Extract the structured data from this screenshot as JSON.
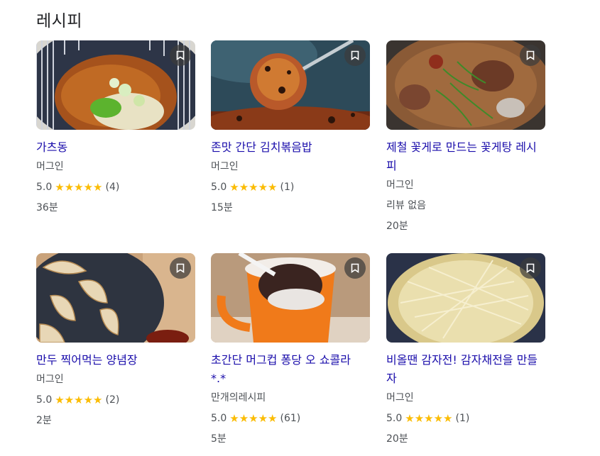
{
  "section": {
    "title": "레시피"
  },
  "recipes": [
    {
      "title": "가츠동",
      "source": "머그인",
      "rating": "5.0",
      "stars": "★★★★★",
      "reviews": "(4)",
      "time": "36분"
    },
    {
      "title": "존맛 간단 김치볶음밥",
      "source": "머그인",
      "rating": "5.0",
      "stars": "★★★★★",
      "reviews": "(1)",
      "time": "15분"
    },
    {
      "title": "제철 꽃게로 만드는 꽃게탕 레시피",
      "source": "머그인",
      "no_review": "리뷰 없음",
      "time": "20분"
    },
    {
      "title": "만두 찍어먹는 양념장",
      "source": "머그인",
      "rating": "5.0",
      "stars": "★★★★★",
      "reviews": "(2)",
      "time": "2분"
    },
    {
      "title": "초간단 머그컵 퐁당 오 쇼콜라 *.*",
      "source": "만개의레시피",
      "rating": "5.0",
      "stars": "★★★★★",
      "reviews": "(61)",
      "time": "5분"
    },
    {
      "title": "비올땐 감자전! 감자채전을 만들자",
      "source": "머그인",
      "rating": "5.0",
      "stars": "★★★★★",
      "reviews": "(1)",
      "time": "20분"
    }
  ],
  "icons": {
    "bookmark": "bookmark-icon"
  },
  "colors": {
    "link": "#1a0dab",
    "star": "#fbbc04",
    "meta": "#4d5156"
  }
}
